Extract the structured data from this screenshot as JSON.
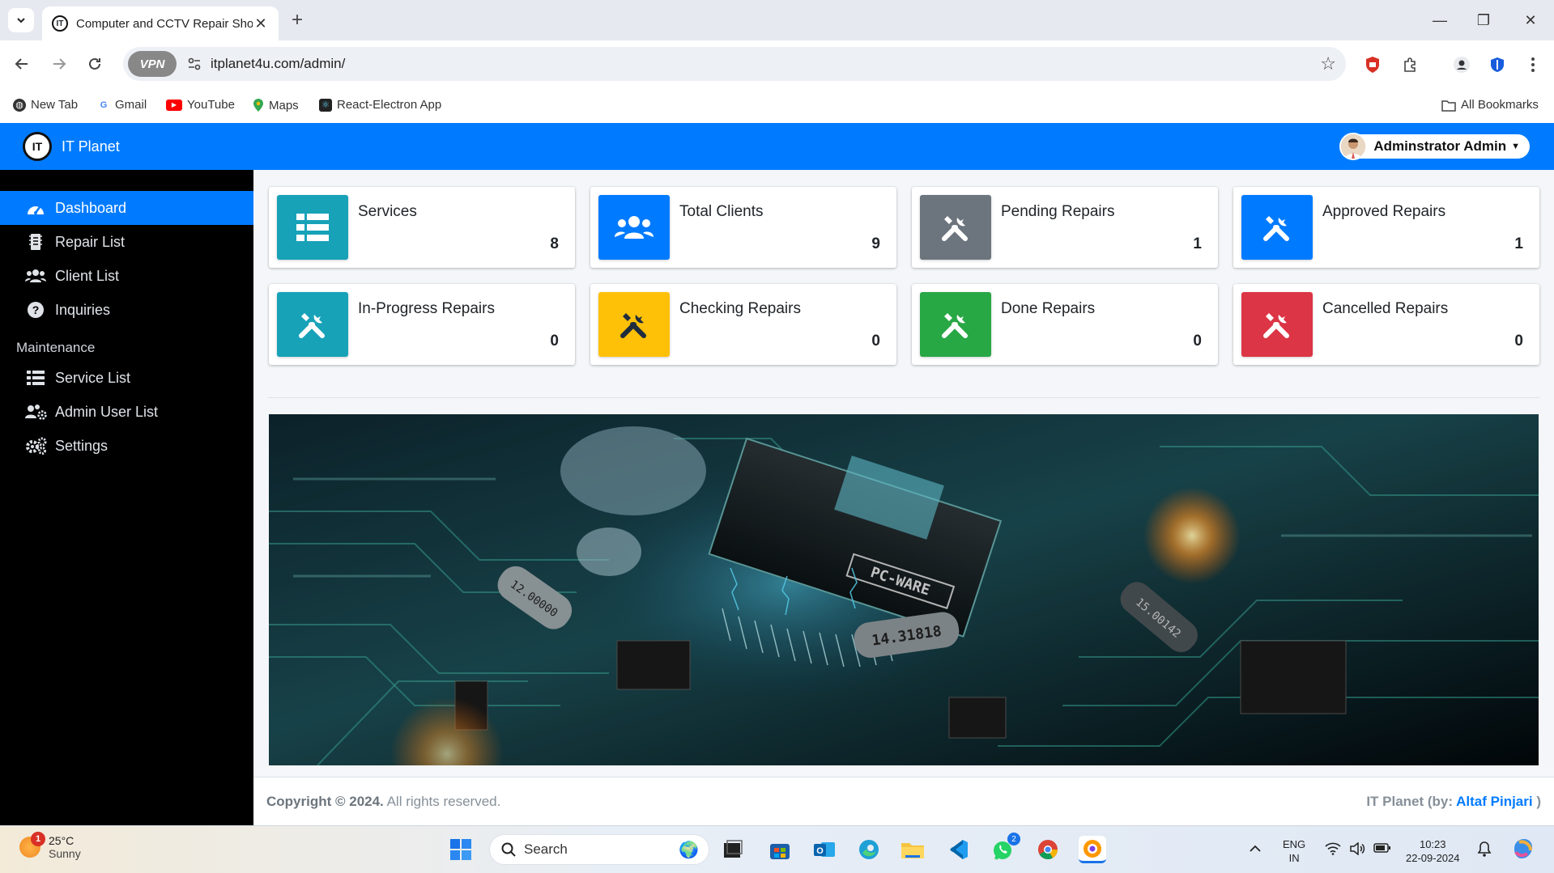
{
  "browser": {
    "tab_title": "Computer and CCTV Repair Sho",
    "url": "itplanet4u.com/admin/",
    "vpn_label": "VPN",
    "bookmarks": [
      {
        "label": "New Tab"
      },
      {
        "label": "Gmail"
      },
      {
        "label": "YouTube"
      },
      {
        "label": "Maps"
      },
      {
        "label": "React-Electron App"
      }
    ],
    "all_bookmarks": "All Bookmarks"
  },
  "app": {
    "brand": "IT Planet",
    "logo_text": "IT",
    "user_name": "Adminstrator Admin",
    "accent_color": "#007bff",
    "sidebar": {
      "items": [
        {
          "label": "Dashboard",
          "icon": "dashboard-icon",
          "active": true
        },
        {
          "label": "Repair List",
          "icon": "file-list-icon"
        },
        {
          "label": "Client List",
          "icon": "users-icon"
        },
        {
          "label": "Inquiries",
          "icon": "question-icon"
        }
      ],
      "section_header": "Maintenance",
      "maintenance_items": [
        {
          "label": "Service List",
          "icon": "list-icon"
        },
        {
          "label": "Admin User List",
          "icon": "users-cog-icon"
        },
        {
          "label": "Settings",
          "icon": "cogs-icon"
        }
      ]
    },
    "cards": [
      {
        "label": "Services",
        "value": "8",
        "color": "#17a2b8",
        "icon": "list-icon"
      },
      {
        "label": "Total Clients",
        "value": "9",
        "color": "#007bff",
        "icon": "users-icon"
      },
      {
        "label": "Pending Repairs",
        "value": "1",
        "color": "#6c757d",
        "icon": "tools-icon"
      },
      {
        "label": "Approved Repairs",
        "value": "1",
        "color": "#007bff",
        "icon": "tools-icon"
      },
      {
        "label": "In-Progress Repairs",
        "value": "0",
        "color": "#17a2b8",
        "icon": "tools-icon"
      },
      {
        "label": "Checking Repairs",
        "value": "0",
        "color": "#ffc107",
        "icon": "tools-icon"
      },
      {
        "label": "Done Repairs",
        "value": "0",
        "color": "#28a745",
        "icon": "tools-icon"
      },
      {
        "label": "Cancelled Repairs",
        "value": "0",
        "color": "#dc3545",
        "icon": "tools-icon"
      }
    ],
    "footer": {
      "copyright_bold": "Copyright © 2024.",
      "copyright_rest": " All rights reserved.",
      "credit_prefix": "IT Planet (by: ",
      "credit_author": "Altaf Pinjari",
      "credit_suffix": " )"
    },
    "banner_chip_labels": [
      "PC-WARE",
      "14.31818",
      "12.00000",
      "15.00142"
    ]
  },
  "taskbar": {
    "temperature": "25°C",
    "condition": "Sunny",
    "weather_badge": "1",
    "search_placeholder": "Search",
    "whatsapp_badge": "2",
    "lang_line1": "ENG",
    "lang_line2": "IN",
    "time": "10:23",
    "date": "22-09-2024"
  }
}
